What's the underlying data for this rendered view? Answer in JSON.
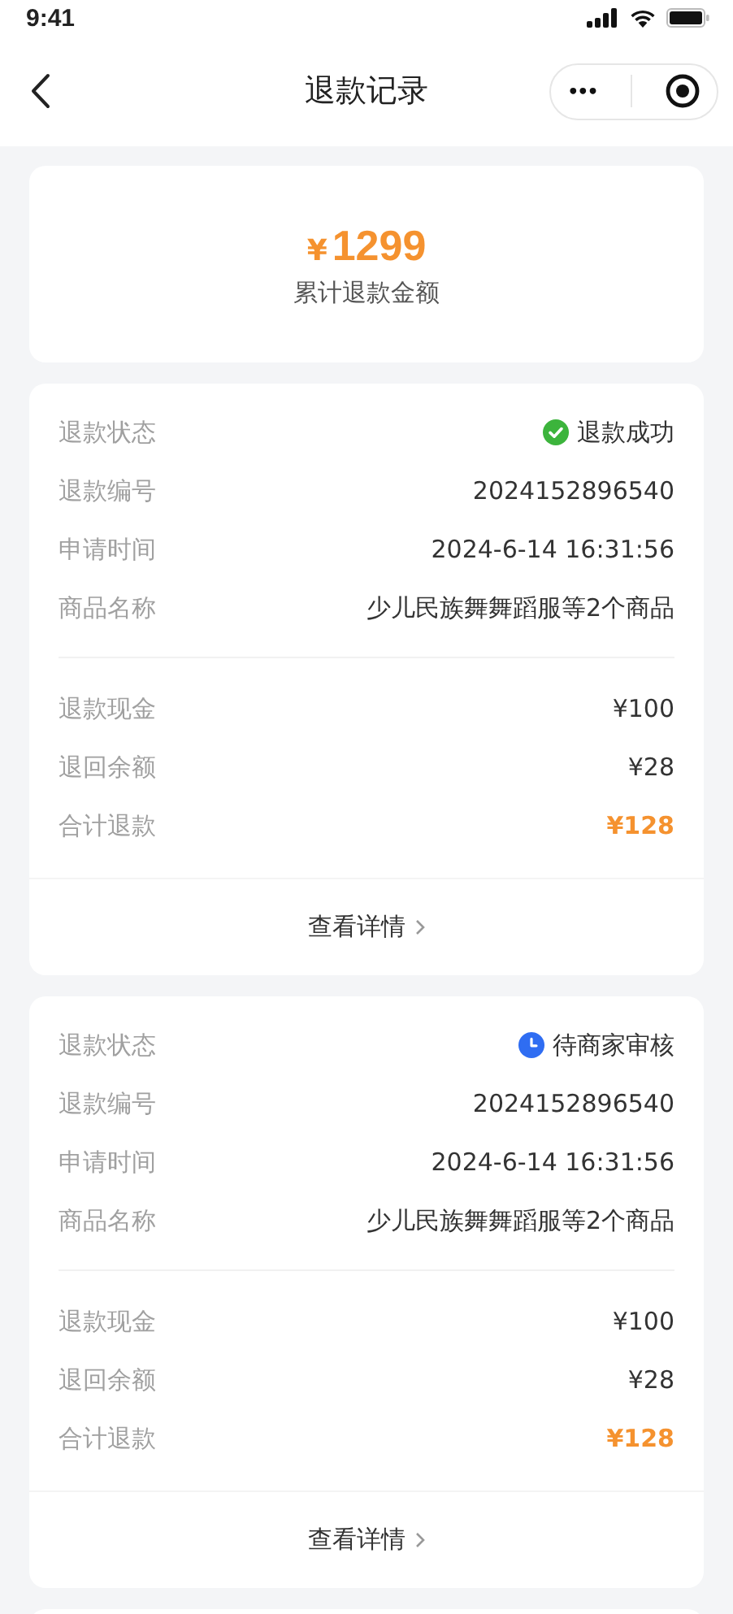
{
  "status_bar": {
    "time": "9:41"
  },
  "nav": {
    "title": "退款记录",
    "more": "•••"
  },
  "summary": {
    "currency": "¥",
    "amount": "1299",
    "label": "累计退款金额"
  },
  "records": [
    {
      "details": [
        {
          "label": "退款状态",
          "value": "退款成功",
          "kind": "success"
        },
        {
          "label": "退款编号",
          "value": "2024152896540",
          "kind": "plain"
        },
        {
          "label": "申请时间",
          "value": "2024-6-14 16:31:56",
          "kind": "plain"
        },
        {
          "label": "商品名称",
          "value": "少儿民族舞舞蹈服等2个商品",
          "kind": "plain"
        }
      ],
      "amounts": [
        {
          "label": "退款现金",
          "value": "¥100",
          "kind": "plain"
        },
        {
          "label": "退回余额",
          "value": "¥28",
          "kind": "plain"
        },
        {
          "label": "合计退款",
          "value": "¥128",
          "kind": "total"
        }
      ],
      "action": "查看详情"
    },
    {
      "details": [
        {
          "label": "退款状态",
          "value": "待商家审核",
          "kind": "pending"
        },
        {
          "label": "退款编号",
          "value": "2024152896540",
          "kind": "plain"
        },
        {
          "label": "申请时间",
          "value": "2024-6-14 16:31:56",
          "kind": "plain"
        },
        {
          "label": "商品名称",
          "value": "少儿民族舞舞蹈服等2个商品",
          "kind": "plain"
        }
      ],
      "amounts": [
        {
          "label": "退款现金",
          "value": "¥100",
          "kind": "plain"
        },
        {
          "label": "退回余额",
          "value": "¥28",
          "kind": "plain"
        },
        {
          "label": "合计退款",
          "value": "¥128",
          "kind": "total"
        }
      ],
      "action": "查看详情"
    }
  ]
}
